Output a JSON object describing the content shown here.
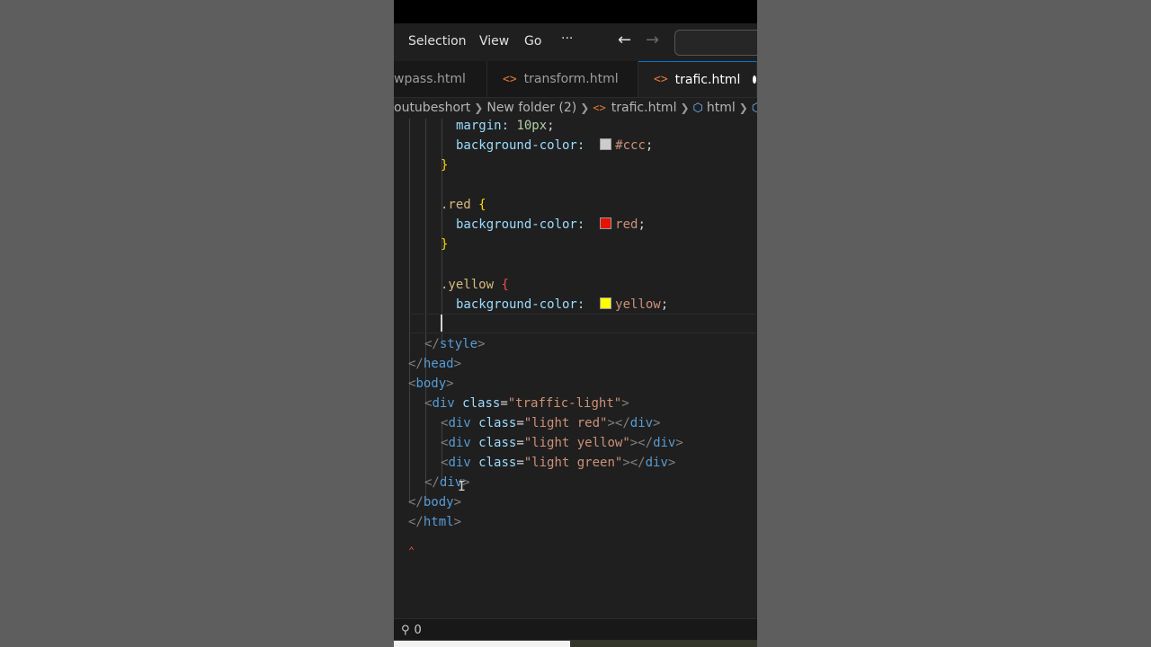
{
  "menu": {
    "selection": "Selection",
    "view": "View",
    "go": "Go",
    "more": "···",
    "back": "←",
    "forward": "→"
  },
  "tabs": [
    {
      "label": "wpass.html",
      "icon": ""
    },
    {
      "label": "transform.html",
      "icon": "<>"
    },
    {
      "label": "trafic.html",
      "icon": "<>"
    }
  ],
  "breadcrumb": {
    "root": "outubeshort",
    "folder": "New folder (2)",
    "file": "trafic.html",
    "node": "html",
    "file_icon": "<>"
  },
  "code": {
    "l1_prop": "margin:",
    "l1_val": "10px",
    "l1_end": ";",
    "l2_prop": "background-color:",
    "l2_val": "#ccc",
    "l2_end": ";",
    "l3": "}",
    "l4_sel": ".red",
    "l4_brace": "{",
    "l5_prop": "background-color:",
    "l5_val": "red",
    "l5_end": ";",
    "l6": "}",
    "l7_sel": ".yellow",
    "l7_brace": "{",
    "l8_prop": "background-color:",
    "l8_val": "yellow",
    "l8_end": ";",
    "l9_open": "</",
    "l9_tag": "style",
    "l9_close": ">",
    "l10_open": "</",
    "l10_tag": "head",
    "l10_close": ">",
    "l11_open": "<",
    "l11_tag": "body",
    "l11_close": ">",
    "l12_open": "<",
    "l12_tag": "div",
    "l12_attr": " class",
    "l12_eq": "=",
    "l12_str": "\"traffic-light\"",
    "l12_close": ">",
    "l13_open": "<",
    "l13_tag": "div",
    "l13_attr": " class",
    "l13_eq": "=",
    "l13_str": "\"light red\"",
    "l13_close": "></",
    "l13_ctag": "div",
    "l13_end": ">",
    "l14_open": "<",
    "l14_tag": "div",
    "l14_attr": " class",
    "l14_eq": "=",
    "l14_str": "\"light yellow\"",
    "l14_close": "></",
    "l14_ctag": "div",
    "l14_end": ">",
    "l15_open": "<",
    "l15_tag": "div",
    "l15_attr": " class",
    "l15_eq": "=",
    "l15_str": "\"light green\"",
    "l15_close": "></",
    "l15_ctag": "div",
    "l15_end": ">",
    "l16_open": "</",
    "l16_tag": "div",
    "l16_close": ">",
    "l17_open": "</",
    "l17_tag": "body",
    "l17_close": ">",
    "l18_open": "</",
    "l18_tag": "html",
    "l18_close": ">"
  },
  "swatches": {
    "ccc": "#cccccc",
    "red": "#e51400",
    "yellow": "#ffff00"
  },
  "status": {
    "ports": "0"
  },
  "icons": {
    "ports": "broadcast-icon",
    "cube": "symbol-cube-icon",
    "unsaved": "unsaved-dot-icon"
  }
}
